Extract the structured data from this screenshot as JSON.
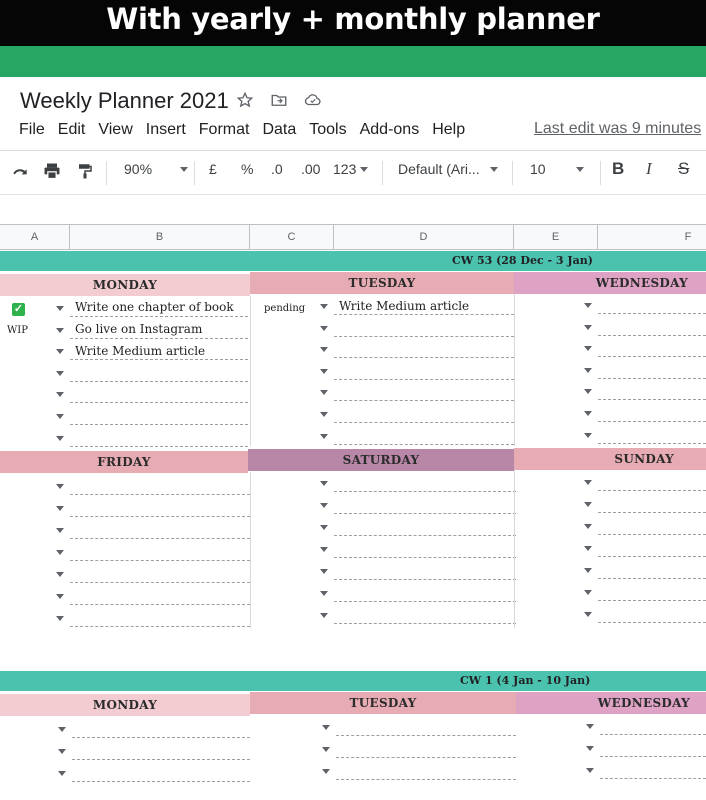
{
  "banner": {
    "text": "With yearly + monthly planner"
  },
  "doc": {
    "title": "Weekly Planner 2021"
  },
  "icons": {
    "star": "star-icon",
    "move": "move-to-folder-icon",
    "cloud": "cloud-saved-icon"
  },
  "menu": {
    "items": [
      "File",
      "Edit",
      "View",
      "Insert",
      "Format",
      "Data",
      "Tools",
      "Add-ons",
      "Help"
    ],
    "last_edit": "Last edit was 9 minutes"
  },
  "toolbar": {
    "zoom": "90%",
    "currency": "£",
    "percent": "%",
    "dec_decrease": ".0",
    "dec_increase": ".00",
    "more_formats": "123",
    "font": "Default (Ari...",
    "font_size": "10",
    "bold": "B",
    "italic": "I",
    "strike": "S"
  },
  "columns": [
    "A",
    "B",
    "C",
    "D",
    "E",
    "F"
  ],
  "weeks": [
    {
      "label": "CW 53 (28 Dec - 3 Jan)",
      "days_top": [
        "MONDAY",
        "TUESDAY",
        "WEDNESDAY"
      ],
      "days_bottom": [
        "FRIDAY",
        "SATURDAY",
        "SUNDAY"
      ]
    },
    {
      "label": "CW 1 (4 Jan - 10 Jan)",
      "days_top": [
        "MONDAY",
        "TUESDAY",
        "WEDNESDAY"
      ]
    }
  ],
  "monday_tasks": [
    {
      "status": "done",
      "text": "Write one chapter of book"
    },
    {
      "status": "WIP",
      "text": "Go live on Instagram"
    },
    {
      "status": "",
      "text": "Write Medium article"
    }
  ],
  "tuesday_tasks": [
    {
      "status": "pending",
      "text": "Write Medium article"
    }
  ],
  "colors": {
    "banner_bg": "#050505",
    "green_band": "#27a562",
    "teal": "#4bc2ad",
    "day_pink_light": "#f2ccd0",
    "day_pink": "#e6abb3",
    "day_lavender": "#dda2c4",
    "day_mauve": "#b887a8",
    "checkbox_green": "#2eb24b"
  }
}
